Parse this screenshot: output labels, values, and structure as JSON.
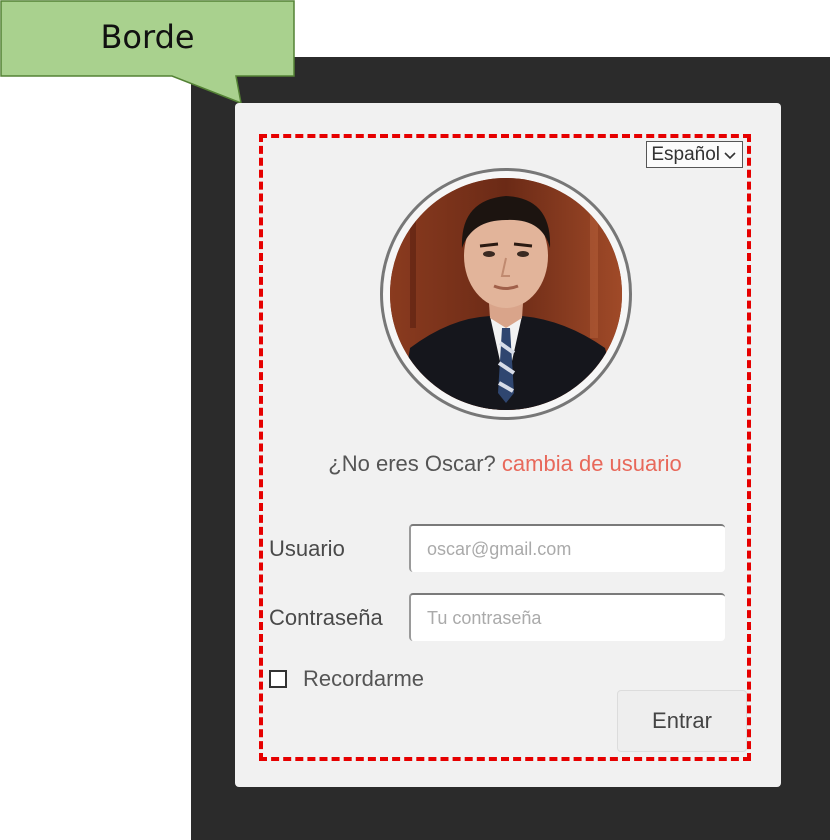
{
  "callout": {
    "label": "Borde"
  },
  "login": {
    "language": "Español",
    "not_you_prefix": "¿No eres Oscar?",
    "change_user_link": "cambia de usuario",
    "username_label": "Usuario",
    "username_placeholder": "oscar@gmail.com",
    "password_label": "Contraseña",
    "password_placeholder": "Tu contraseña",
    "remember_label": "Recordarme",
    "submit_label": "Entrar"
  },
  "colors": {
    "callout_fill": "#a9d18e",
    "callout_stroke": "#548235",
    "border_dash": "#e60000",
    "link": "#e8685a",
    "background_dark": "#2b2b2b",
    "card": "#f1f1f1"
  },
  "icons": {
    "language_dropdown": "chevron-down-icon",
    "avatar": "user-photo"
  }
}
